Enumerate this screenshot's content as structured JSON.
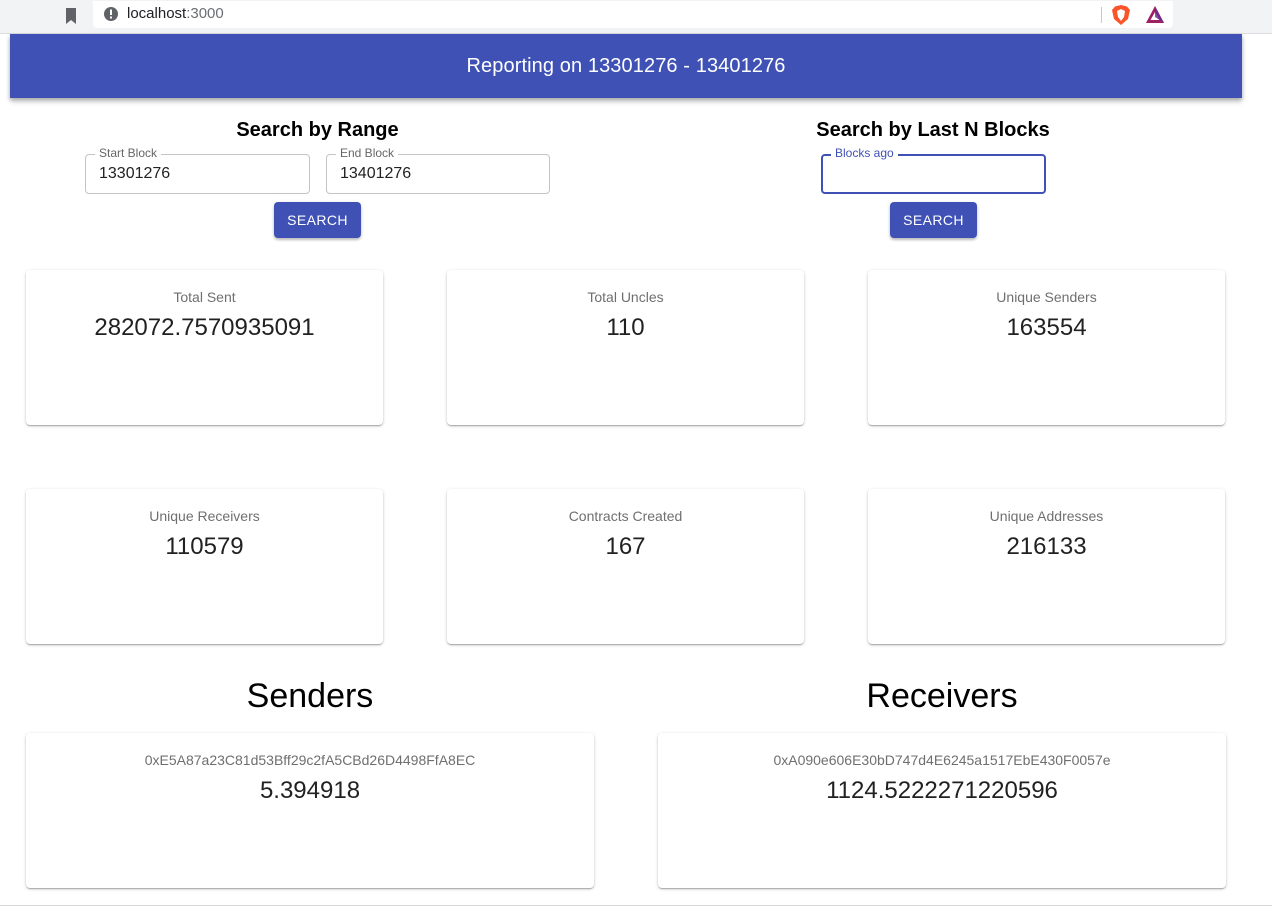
{
  "browser": {
    "url_host": "localhost",
    "url_port": ":3000"
  },
  "header": {
    "title": "Reporting on 13301276 - 13401276"
  },
  "range_search": {
    "heading": "Search by Range",
    "start_label": "Start Block",
    "start_value": "13301276",
    "end_label": "End Block",
    "end_value": "13401276",
    "button_label": "SEARCH"
  },
  "lastn_search": {
    "heading": "Search by Last N Blocks",
    "blocks_label": "Blocks ago",
    "blocks_value": "",
    "button_label": "SEARCH"
  },
  "stats": [
    {
      "label": "Total Sent",
      "value": "282072.7570935091"
    },
    {
      "label": "Total Uncles",
      "value": "110"
    },
    {
      "label": "Unique Senders",
      "value": "163554"
    },
    {
      "label": "Unique Receivers",
      "value": "110579"
    },
    {
      "label": "Contracts Created",
      "value": "167"
    },
    {
      "label": "Unique Addresses",
      "value": "216133"
    }
  ],
  "senders": {
    "heading": "Senders",
    "items": [
      {
        "address": "0xE5A87a23C81d53Bff29c2fA5CBd26D4498FfA8EC",
        "amount": "5.394918"
      }
    ]
  },
  "receivers": {
    "heading": "Receivers",
    "items": [
      {
        "address": "0xA090e606E30bD747d4E6245a1517EbE430F0057e",
        "amount": "1124.5222271220596"
      }
    ]
  },
  "colors": {
    "primary": "#3f51b5"
  }
}
